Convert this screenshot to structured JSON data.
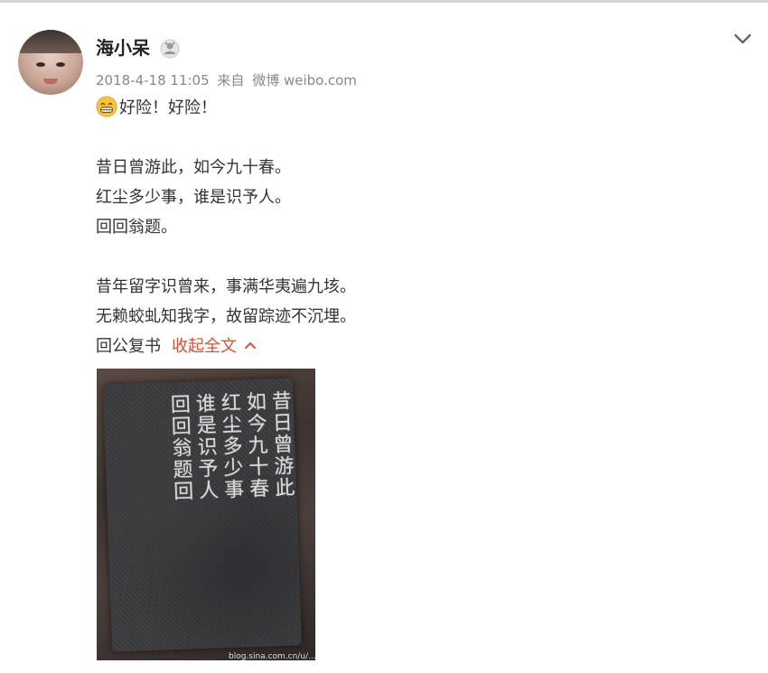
{
  "post": {
    "username": "海小呆",
    "timestamp": "2018-4-18 11:05",
    "source_prefix": "来自",
    "source_name": "微博 weibo.com",
    "lines": [
      "好险！好险！",
      "昔日曾游此，如今九十春。",
      "红尘多少事，谁是识予人。",
      "回回翁题。",
      "昔年留字识曾来，事满华夷遍九垓。",
      "无赖蛟虬知我字，故留踪迹不沉埋。",
      "回公复书"
    ],
    "collapse_label": "收起全文"
  },
  "image": {
    "watermark": "blog.sina.com.cn/u/... @海小呆",
    "inscription_columns": "昔日曾游此\n如今九十春\n红尘多少事\n谁是识予人\n回回翁题回"
  },
  "icons": {
    "member": "member-badge-icon",
    "options": "chevron-down-icon",
    "emoji": "grinning-emoji-icon",
    "collapse": "chevron-up-icon"
  },
  "colors": {
    "link": "#d0533a",
    "meta": "#888888",
    "text": "#333333"
  }
}
